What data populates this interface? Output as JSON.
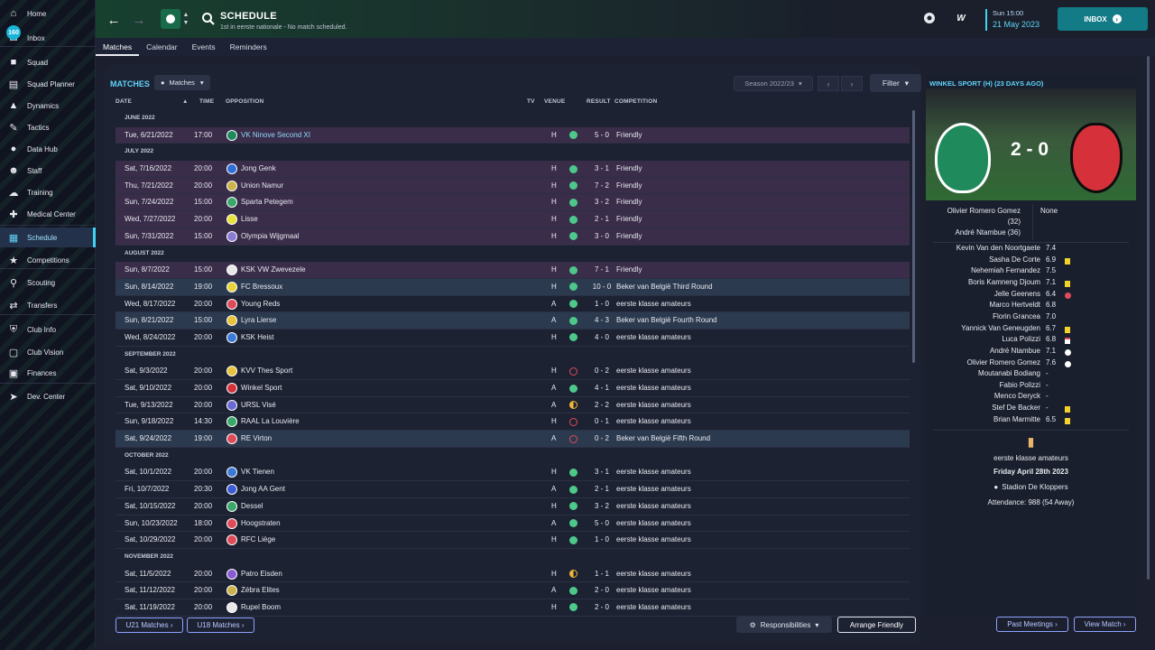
{
  "sidebar": {
    "items": [
      {
        "label": "Home",
        "icon": "home-icon"
      },
      {
        "label": "Inbox",
        "icon": "inbox-icon"
      },
      {
        "label": "Squad",
        "icon": "shirt-icon"
      },
      {
        "label": "Squad Planner",
        "icon": "clipboard-icon"
      },
      {
        "label": "Dynamics",
        "icon": "dynamics-icon"
      },
      {
        "label": "Tactics",
        "icon": "tactics-icon"
      },
      {
        "label": "Data Hub",
        "icon": "data-hub-icon"
      },
      {
        "label": "Staff",
        "icon": "staff-icon"
      },
      {
        "label": "Training",
        "icon": "training-icon"
      },
      {
        "label": "Medical Center",
        "icon": "medical-icon"
      },
      {
        "label": "Schedule",
        "icon": "calendar-icon"
      },
      {
        "label": "Competitions",
        "icon": "trophy-icon"
      },
      {
        "label": "Scouting",
        "icon": "scouting-icon"
      },
      {
        "label": "Transfers",
        "icon": "transfers-icon"
      },
      {
        "label": "Club Info",
        "icon": "shield-icon"
      },
      {
        "label": "Club Vision",
        "icon": "briefcase-icon"
      },
      {
        "label": "Finances",
        "icon": "finances-icon"
      },
      {
        "label": "Dev. Center",
        "icon": "dev-center-icon"
      }
    ],
    "inbox_badge": "160",
    "active": "Schedule"
  },
  "header": {
    "title": "SCHEDULE",
    "subtitle": "1st in eerste nationale - No match scheduled.",
    "tabs": [
      "Matches",
      "Calendar",
      "Events",
      "Reminders"
    ],
    "date_line1": "Sun 15:00",
    "date_line2": "21 May 2023",
    "inbox_button": "INBOX"
  },
  "main": {
    "section_title": "MATCHES",
    "view_dropdown": "Matches",
    "season": "Season 2022/23",
    "filter": "Filter",
    "columns": {
      "date": "DATE",
      "time": "TIME",
      "opposition": "OPPOSITION",
      "tv": "TV",
      "venue": "VENUE",
      "result": "RESULT",
      "competition": "COMPETITION"
    },
    "months": [
      "JUNE 2022",
      "JULY 2022",
      "AUGUST 2022",
      "SEPTEMBER 2022",
      "OCTOBER 2022",
      "NOVEMBER 2022"
    ],
    "matches": [
      {
        "m": 0,
        "date": "Tue, 6/21/2022",
        "time": "17:00",
        "opp": "VK Ninove Second XI",
        "venue": "H",
        "outcome": "win",
        "result": "5 - 0",
        "comp": "Friendly",
        "kind": "friendly",
        "crest": "#1f8a5b"
      },
      {
        "m": 1,
        "date": "Sat, 7/16/2022",
        "time": "20:00",
        "opp": "Jong Genk",
        "venue": "H",
        "outcome": "win",
        "result": "3 - 1",
        "comp": "Friendly",
        "kind": "friendly",
        "crest": "#2f6fd6"
      },
      {
        "m": 1,
        "date": "Thu, 7/21/2022",
        "time": "20:00",
        "opp": "Union Namur",
        "venue": "H",
        "outcome": "win",
        "result": "7 - 2",
        "comp": "Friendly",
        "kind": "friendly",
        "crest": "#cbb24a"
      },
      {
        "m": 1,
        "date": "Sun, 7/24/2022",
        "time": "15:00",
        "opp": "Sparta Petegem",
        "venue": "H",
        "outcome": "win",
        "result": "3 - 2",
        "comp": "Friendly",
        "kind": "friendly",
        "crest": "#3aa86a"
      },
      {
        "m": 1,
        "date": "Wed, 7/27/2022",
        "time": "20:00",
        "opp": "Lisse",
        "venue": "H",
        "outcome": "win",
        "result": "2 - 1",
        "comp": "Friendly",
        "kind": "friendly",
        "crest": "#e8e23a"
      },
      {
        "m": 1,
        "date": "Sun, 7/31/2022",
        "time": "15:00",
        "opp": "Olympia Wijgmaal",
        "venue": "H",
        "outcome": "win",
        "result": "3 - 0",
        "comp": "Friendly",
        "kind": "friendly",
        "crest": "#8a7bd6"
      },
      {
        "m": 2,
        "date": "Sun, 8/7/2022",
        "time": "15:00",
        "opp": "KSK VW Zwevezele",
        "venue": "H",
        "outcome": "win",
        "result": "7 - 1",
        "comp": "Friendly",
        "kind": "friendly",
        "crest": "#e8e8e8"
      },
      {
        "m": 2,
        "date": "Sun, 8/14/2022",
        "time": "19:00",
        "opp": "FC Bressoux",
        "venue": "H",
        "outcome": "win",
        "result": "10 - 0",
        "comp": "Beker van België Third Round",
        "kind": "cup",
        "crest": "#e8d43a"
      },
      {
        "m": 2,
        "date": "Wed, 8/17/2022",
        "time": "20:00",
        "opp": "Young Reds",
        "venue": "A",
        "outcome": "win",
        "result": "1 - 0",
        "comp": "eerste klasse amateurs",
        "kind": "league",
        "crest": "#e04b5a"
      },
      {
        "m": 2,
        "date": "Sun, 8/21/2022",
        "time": "15:00",
        "opp": "Lyra Lierse",
        "venue": "A",
        "outcome": "win",
        "result": "4 - 3",
        "comp": "Beker van België Fourth Round",
        "kind": "cup",
        "crest": "#e8c23a"
      },
      {
        "m": 2,
        "date": "Wed, 8/24/2022",
        "time": "20:00",
        "opp": "KSK Heist",
        "venue": "H",
        "outcome": "win",
        "result": "4 - 0",
        "comp": "eerste klasse amateurs",
        "kind": "league",
        "crest": "#3a7ad6"
      },
      {
        "m": 3,
        "date": "Sat, 9/3/2022",
        "time": "20:00",
        "opp": "KVV Thes Sport",
        "venue": "H",
        "outcome": "loss",
        "result": "0 - 2",
        "comp": "eerste klasse amateurs",
        "kind": "league",
        "crest": "#e8c23a"
      },
      {
        "m": 3,
        "date": "Sat, 9/10/2022",
        "time": "20:00",
        "opp": "Winkel Sport",
        "venue": "A",
        "outcome": "win",
        "result": "4 - 1",
        "comp": "eerste klasse amateurs",
        "kind": "league",
        "crest": "#d6313b"
      },
      {
        "m": 3,
        "date": "Tue, 9/13/2022",
        "time": "20:00",
        "opp": "URSL Visé",
        "venue": "A",
        "outcome": "draw",
        "result": "2 - 2",
        "comp": "eerste klasse amateurs",
        "kind": "league",
        "crest": "#6a6ad6"
      },
      {
        "m": 3,
        "date": "Sun, 9/18/2022",
        "time": "14:30",
        "opp": "RAAL La Louvière",
        "venue": "H",
        "outcome": "loss",
        "result": "0 - 1",
        "comp": "eerste klasse amateurs",
        "kind": "league",
        "crest": "#3aa86a"
      },
      {
        "m": 3,
        "date": "Sat, 9/24/2022",
        "time": "19:00",
        "opp": "RE Virton",
        "venue": "A",
        "outcome": "loss",
        "result": "0 - 2",
        "comp": "Beker van België Fifth Round",
        "kind": "cup",
        "crest": "#e04b5a"
      },
      {
        "m": 4,
        "date": "Sat, 10/1/2022",
        "time": "20:00",
        "opp": "VK Tienen",
        "venue": "H",
        "outcome": "win",
        "result": "3 - 1",
        "comp": "eerste klasse amateurs",
        "kind": "league",
        "crest": "#3a7ad6"
      },
      {
        "m": 4,
        "date": "Fri, 10/7/2022",
        "time": "20:30",
        "opp": "Jong AA Gent",
        "venue": "A",
        "outcome": "win",
        "result": "2 - 1",
        "comp": "eerste klasse amateurs",
        "kind": "league",
        "crest": "#3a5ad6"
      },
      {
        "m": 4,
        "date": "Sat, 10/15/2022",
        "time": "20:00",
        "opp": "Dessel",
        "venue": "H",
        "outcome": "win",
        "result": "3 - 2",
        "comp": "eerste klasse amateurs",
        "kind": "league",
        "crest": "#3aa86a"
      },
      {
        "m": 4,
        "date": "Sun, 10/23/2022",
        "time": "18:00",
        "opp": "Hoogstraten",
        "venue": "A",
        "outcome": "win",
        "result": "5 - 0",
        "comp": "eerste klasse amateurs",
        "kind": "league",
        "crest": "#e04b5a"
      },
      {
        "m": 4,
        "date": "Sat, 10/29/2022",
        "time": "20:00",
        "opp": "RFC Liège",
        "venue": "H",
        "outcome": "win",
        "result": "1 - 0",
        "comp": "eerste klasse amateurs",
        "kind": "league",
        "crest": "#e04b5a"
      },
      {
        "m": 5,
        "date": "Sat, 11/5/2022",
        "time": "20:00",
        "opp": "Patro Eisden",
        "venue": "H",
        "outcome": "draw",
        "result": "1 - 1",
        "comp": "eerste klasse amateurs",
        "kind": "league",
        "crest": "#8a5ad6"
      },
      {
        "m": 5,
        "date": "Sat, 11/12/2022",
        "time": "20:00",
        "opp": "Zébra Elites",
        "venue": "A",
        "outcome": "win",
        "result": "2 - 0",
        "comp": "eerste klasse amateurs",
        "kind": "league",
        "crest": "#cbb24a"
      },
      {
        "m": 5,
        "date": "Sat, 11/19/2022",
        "time": "20:00",
        "opp": "Rupel Boom",
        "venue": "H",
        "outcome": "win",
        "result": "2 - 0",
        "comp": "eerste klasse amateurs",
        "kind": "league",
        "crest": "#e8e8e8"
      }
    ],
    "bottom": {
      "u21": "U21 Matches",
      "u18": "U18 Matches",
      "responsibilities": "Responsibilities",
      "arrange": "Arrange Friendly"
    }
  },
  "match_panel": {
    "title": "WINKEL SPORT (H) (23 DAYS AGO)",
    "score": "2 - 0",
    "scorer_1": "Olivier Romero Gomez",
    "scorer_1_min": "(32)",
    "scorer_2": "André Ntambue (36)",
    "away_scorers": "None",
    "players": [
      {
        "name": "Kevin Van den Noortgaete",
        "rating": "7.4",
        "event": ""
      },
      {
        "name": "Sasha De Corte",
        "rating": "6.9",
        "event": "yellow"
      },
      {
        "name": "Nehemiah Fernandez",
        "rating": "7.5",
        "event": ""
      },
      {
        "name": "Boris Kamneng Djoum",
        "rating": "7.1",
        "event": "yellow"
      },
      {
        "name": "Jelle Geenens",
        "rating": "6.4",
        "event": "sub"
      },
      {
        "name": "Marco Hertveldt",
        "rating": "6.8",
        "event": ""
      },
      {
        "name": "Florin Grancea",
        "rating": "7.0",
        "event": ""
      },
      {
        "name": "Yannick Van Geneugden",
        "rating": "6.7",
        "event": "yellow"
      },
      {
        "name": "Luca Polizzi",
        "rating": "6.8",
        "event": "injury"
      },
      {
        "name": "André Ntambue",
        "rating": "7.1",
        "event": "goal"
      },
      {
        "name": "Olivier Romero Gomez",
        "rating": "7.6",
        "event": "goal"
      },
      {
        "name": "Moutanabi Bodiang",
        "rating": "-",
        "event": ""
      },
      {
        "name": "Fabio Polizzi",
        "rating": "-",
        "event": ""
      },
      {
        "name": "Menco Deryck",
        "rating": "-",
        "event": ""
      },
      {
        "name": "Stef De Backer",
        "rating": "-",
        "event": "yellow"
      },
      {
        "name": "Brian Marmitte",
        "rating": "6.5",
        "event": "yellow"
      }
    ],
    "competition": "eerste klasse amateurs",
    "date": "Friday April 28th 2023",
    "stadium": "Stadion De Kloppers",
    "attendance": "Attendance: 988 (54 Away)",
    "past_meetings": "Past Meetings",
    "view_match": "View Match"
  }
}
